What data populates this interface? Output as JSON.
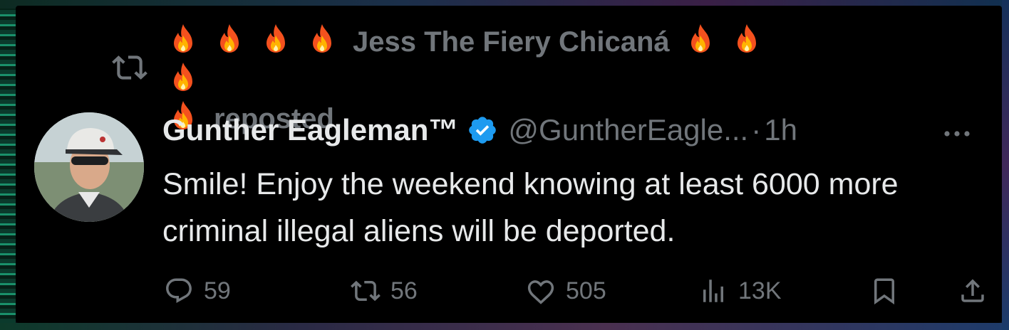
{
  "repost": {
    "user_name": "Jess The Fiery Chicaná",
    "label": "reposted",
    "emoji": "fire"
  },
  "tweet": {
    "author_name": "Gunther Eagleman™",
    "verified": true,
    "handle": "@GuntherEagle...",
    "separator": "·",
    "time": "1h",
    "text": "Smile!  Enjoy the weekend knowing at least 6000 more criminal illegal aliens will be deported."
  },
  "actions": {
    "replies": "59",
    "reposts": "56",
    "likes": "505",
    "views": "13K"
  },
  "colors": {
    "background": "#000000",
    "primary_text": "#e7e9ea",
    "secondary_text": "#71767b",
    "verified_blue": "#1d9bf0"
  }
}
